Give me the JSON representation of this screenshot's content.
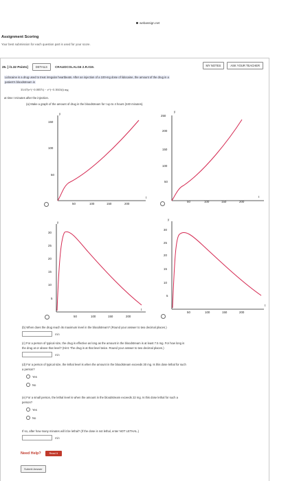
{
  "header": {
    "site": "webassign.net"
  },
  "assignment": {
    "title": "Assignment Scoring",
    "subtitle": "Your best submission for each question part is used for your score."
  },
  "question": {
    "number": "25.",
    "points": "[-/1.32 Points]",
    "details_label": "DETAILS",
    "code": "CRAUDCOLALG6 2.R.019.",
    "my_notes_label": "MY NOTES",
    "ask_teacher_label": "ASK YOUR TEACHER",
    "stem_line1": "Lidocaine is a drug used to treat irregular heartbeats. After an injection of a 100-mg dose of lidocaine, the amount of the drug in a",
    "stem_line2": "patient's bloodstream is",
    "equation": "33.67(e^(−0.0057t) − e^(−0.1043t)) mg",
    "stem_line3": "at time t minutes after the injection.",
    "part_a": "(a) Make a graph of the amount of drug in the bloodstream for t up to 4 hours (240 minutes)."
  },
  "graphs": [
    {
      "ylabel": "y",
      "xlabel": "t",
      "yticks": [
        "150",
        "100",
        "50"
      ],
      "xticks": [
        "50",
        "100",
        "150",
        "200"
      ],
      "origin": "O"
    },
    {
      "ylabel": "y",
      "xlabel": "t",
      "yticks": [
        "250",
        "200",
        "150",
        "100",
        "50"
      ],
      "xticks": [
        "50",
        "100",
        "150",
        "200"
      ],
      "origin": "O"
    },
    {
      "ylabel": "y",
      "xlabel": "t",
      "yticks": [
        "30",
        "25",
        "20",
        "15",
        "10",
        "5"
      ],
      "xticks": [
        "50",
        "100",
        "150",
        "200"
      ],
      "origin": "O"
    },
    {
      "ylabel": "y",
      "xlabel": "t",
      "yticks": [
        "30",
        "25",
        "20",
        "15",
        "10",
        "5"
      ],
      "xticks": [
        "50",
        "100",
        "150",
        "200"
      ],
      "origin": "O"
    }
  ],
  "parts": {
    "b": {
      "text": "(b) When does the drug reach its maximum level in the bloodstream? (Round your answer to two decimal places.)",
      "unit": "min",
      "value": ""
    },
    "c": {
      "text1": "(c) For a person of typical size, the drug is effective as long as the amount in the bloodstream is at least 7.5 mg. For how long is",
      "text2": "the drug at or above that level? (Hint: The drug is at that level twice. Round your answer to two decimal places.)",
      "unit": "min",
      "value": ""
    },
    "d": {
      "text1": "(d) For a person of typical size, the lethal level is when the amount in the bloodstream exceeds 30 mg. Is this dose lethal for such",
      "text2": "a person?",
      "yes": "Yes",
      "no": "No"
    },
    "e": {
      "text1": "(e) For a small person, the lethal level is when the amount in the bloodstream exceeds 22 mg. Is this dose lethal for such a",
      "text2": "person?",
      "yes": "Yes",
      "no": "No"
    },
    "f": {
      "text": "If so, after how many minutes will it be lethal? (If the dose is not lethal, enter NOT LETHAL.)",
      "unit": "min",
      "value": ""
    }
  },
  "help": {
    "label": "Need Help?",
    "read_it": "Read It"
  },
  "submit_label": "Submit Answer"
}
